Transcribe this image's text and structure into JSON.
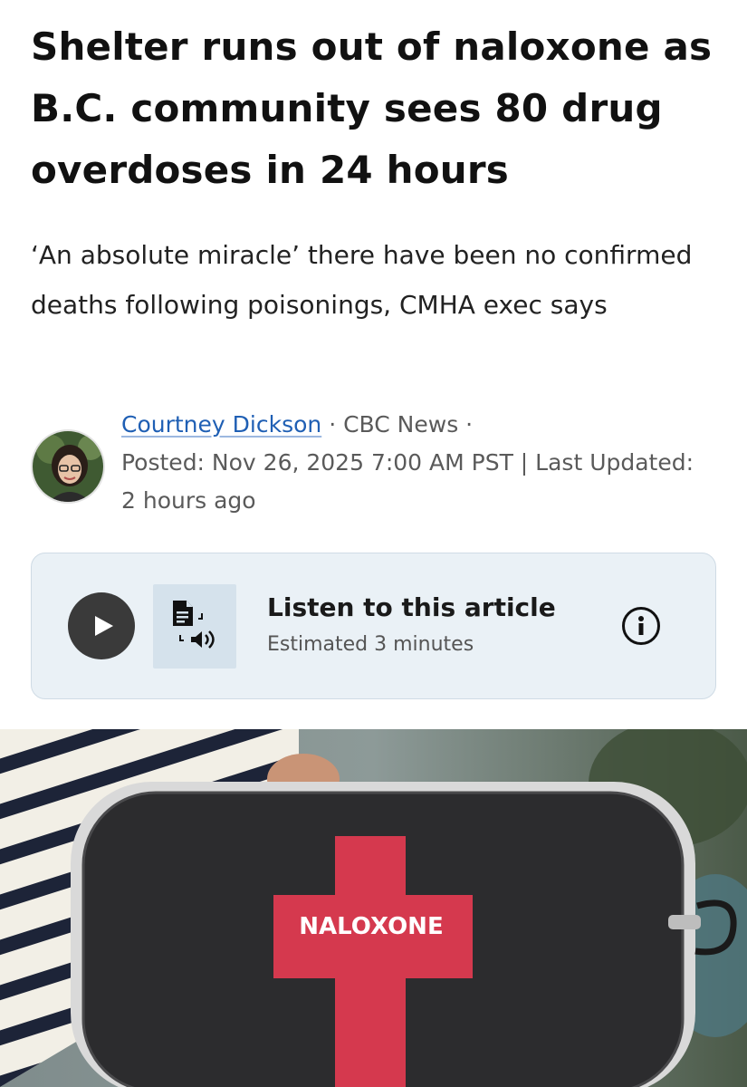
{
  "article": {
    "headline": "Shelter runs out of naloxone as B.C. community sees 80 drug overdoses in 24 hours",
    "deck": "‘An absolute miracle’ there have been no confirmed deaths following poisonings, CMHA exec says"
  },
  "byline": {
    "author": "Courtney Dickson",
    "outlet": "CBC News",
    "posted": "Posted: Nov 26, 2025 7:00 AM PST | Last Updated: 2 hours ago",
    "avatar_icon": "author-photo"
  },
  "audio_player": {
    "title": "Listen to this article",
    "duration": "Estimated 3 minutes",
    "play_icon": "play-icon",
    "tts_icon": "text-to-speech-icon",
    "info_icon": "info-icon"
  },
  "hero_image": {
    "label": "NALOXONE"
  },
  "colors": {
    "author_link": "#1f5fb4",
    "player_bg": "#eaf1f6",
    "cross_red": "#d5394e"
  }
}
